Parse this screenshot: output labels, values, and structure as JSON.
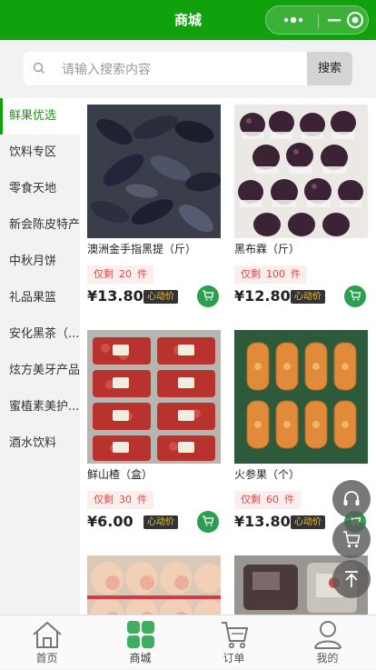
{
  "header": {
    "title": "商城"
  },
  "search": {
    "placeholder": "请输入搜索内容",
    "button_label": "搜索"
  },
  "sidebar": {
    "items": [
      {
        "label": "鲜果优选",
        "active": true
      },
      {
        "label": "饮料专区",
        "active": false
      },
      {
        "label": "零食天地",
        "active": false
      },
      {
        "label": "新会陈皮特产",
        "active": false
      },
      {
        "label": "中秋月饼",
        "active": false
      },
      {
        "label": "礼品果篮",
        "active": false
      },
      {
        "label": "安化黑茶（...",
        "active": false
      },
      {
        "label": "炫方美牙产品",
        "active": false
      },
      {
        "label": "蜜植素美护...",
        "active": false
      },
      {
        "label": "酒水饮料",
        "active": false
      }
    ]
  },
  "products": [
    {
      "name": "澳洲金手指黑提（斤）",
      "stock_prefix": "仅剩",
      "stock": "20",
      "stock_unit": "件",
      "price": "¥13.80",
      "tag": "心动价"
    },
    {
      "name": "黑布霖（斤）",
      "stock_prefix": "仅剩",
      "stock": "100",
      "stock_unit": "件",
      "price": "¥12.80",
      "tag": "心动价"
    },
    {
      "name": "鲜山楂（盒）",
      "stock_prefix": "仅剩",
      "stock": "30",
      "stock_unit": "件",
      "price": "¥6.00",
      "tag": "心动价"
    },
    {
      "name": "火参果（个）",
      "stock_prefix": "仅剩",
      "stock": "60",
      "stock_unit": "件",
      "price": "¥13.80",
      "tag": "心动价"
    }
  ],
  "tabbar": {
    "items": [
      {
        "label": "首页",
        "icon": "home-icon"
      },
      {
        "label": "商城",
        "icon": "grid-icon"
      },
      {
        "label": "订单",
        "icon": "cart-icon"
      },
      {
        "label": "我的",
        "icon": "user-icon"
      }
    ]
  },
  "colors": {
    "accent": "#11a10c",
    "price_tag_bg": "#333333",
    "stock_text": "#e34646"
  }
}
